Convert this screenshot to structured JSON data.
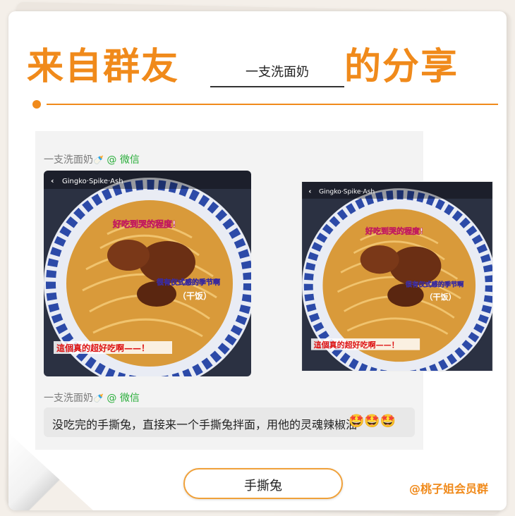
{
  "header": {
    "title_left": "来自群友",
    "blank_name": "一支洗面奶",
    "title_right": "的分享"
  },
  "chat": {
    "sender_name": "一支洗面奶",
    "sender_icon": "baby-bottle-icon",
    "platform_label": "@ 微信",
    "message": "没吃完的手撕兔，直接来一个手撕兔拌面，用他的灵魂辣椒油",
    "message_emojis": "🤩🤩🤩"
  },
  "photo_overlay": {
    "username": "Gingko‧Spike‧Ash",
    "line1": "好吃到哭的程度!",
    "line2": "很有仪式感的季节啊",
    "line3": "（干饭）",
    "line4": "這個真的超好吃啊——！"
  },
  "footer": {
    "tag": "手撕兔",
    "brand": "@桃子姐会员群"
  },
  "colors": {
    "accent": "#f08a1b",
    "wechat_green": "#2aae3b",
    "panel_bg": "#f3f3f3"
  }
}
